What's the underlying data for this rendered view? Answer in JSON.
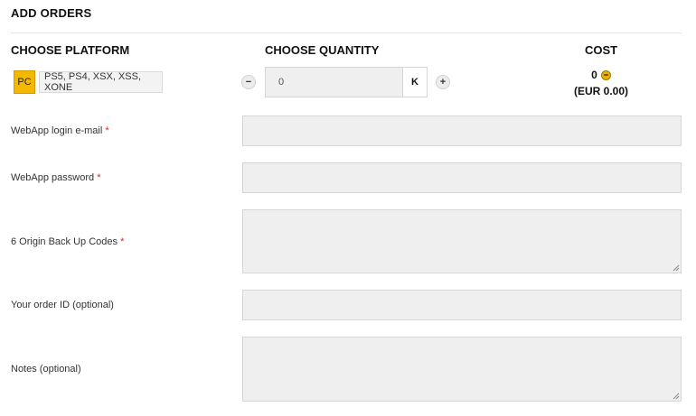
{
  "title": "ADD ORDERS",
  "headers": {
    "platform": "CHOOSE PLATFORM",
    "quantity": "CHOOSE QUANTITY",
    "cost": "COST"
  },
  "platforms": [
    {
      "label": "PC",
      "selected": true
    },
    {
      "label": "PS5, PS4, XSX, XSS, XONE",
      "selected": false
    }
  ],
  "quantity": {
    "minus": "−",
    "value": "0",
    "unit": "K",
    "plus": "+"
  },
  "cost": {
    "coins": "0",
    "eur": "(EUR 0.00)"
  },
  "form": {
    "email_label": "WebApp login e-mail",
    "password_label": "WebApp password",
    "backup_label": "6 Origin Back Up Codes",
    "order_id_label": "Your order ID (optional)",
    "notes_label": "Notes (optional)",
    "required_mark": "*"
  },
  "colors": {
    "accent": "#f5b800",
    "required": "#d9262c",
    "field_bg": "#efefef"
  },
  "icons": {
    "coin": "coin-icon",
    "resize": "resize-grip-icon"
  }
}
